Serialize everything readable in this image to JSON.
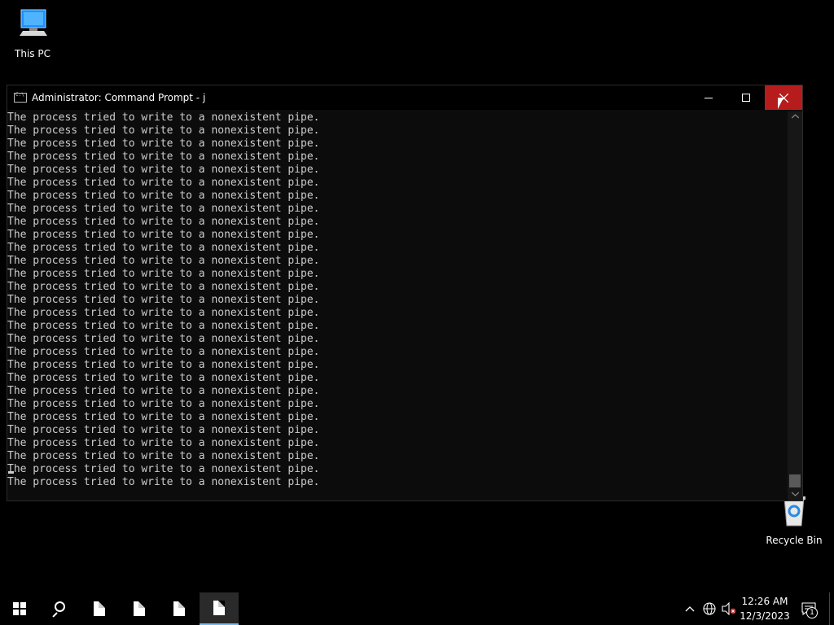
{
  "desktop": {
    "icons": [
      {
        "label": "This PC",
        "icon": "computer-icon"
      },
      {
        "label": "Recycle Bin",
        "icon": "recycle-bin-icon"
      }
    ]
  },
  "window": {
    "title": "Administrator: Command Prompt - j",
    "controls": {
      "minimize": "minimize-icon",
      "maximize": "maximize-icon",
      "close": "close-icon"
    },
    "console_lines": [
      "The process tried to write to a nonexistent pipe.",
      "The process tried to write to a nonexistent pipe.",
      "The process tried to write to a nonexistent pipe.",
      "The process tried to write to a nonexistent pipe.",
      "The process tried to write to a nonexistent pipe.",
      "The process tried to write to a nonexistent pipe.",
      "The process tried to write to a nonexistent pipe.",
      "The process tried to write to a nonexistent pipe.",
      "The process tried to write to a nonexistent pipe.",
      "The process tried to write to a nonexistent pipe.",
      "The process tried to write to a nonexistent pipe.",
      "The process tried to write to a nonexistent pipe.",
      "The process tried to write to a nonexistent pipe.",
      "The process tried to write to a nonexistent pipe.",
      "The process tried to write to a nonexistent pipe.",
      "The process tried to write to a nonexistent pipe.",
      "The process tried to write to a nonexistent pipe.",
      "The process tried to write to a nonexistent pipe.",
      "The process tried to write to a nonexistent pipe.",
      "The process tried to write to a nonexistent pipe.",
      "The process tried to write to a nonexistent pipe.",
      "The process tried to write to a nonexistent pipe.",
      "The process tried to write to a nonexistent pipe.",
      "The process tried to write to a nonexistent pipe.",
      "The process tried to write to a nonexistent pipe.",
      "The process tried to write to a nonexistent pipe.",
      "The process tried to write to a nonexistent pipe.",
      "The process tried to write to a nonexistent pipe.",
      "The process tried to write to a nonexistent pipe."
    ],
    "scroll_position": 1.0
  },
  "taskbar": {
    "items": [
      "start-icon",
      "search-icon",
      "file-icon",
      "file-icon",
      "file-icon",
      "file-icon"
    ],
    "active_index": 5,
    "tray": {
      "time": "12:26 AM",
      "date": "12/3/2023",
      "notification_count": "1"
    }
  },
  "colors": {
    "console_text": "#cccccc",
    "console_bg": "#0c0c0c",
    "close_button": "#b71c1c",
    "taskbar_bg": "#000000",
    "active_task_underline": "#76b9ed"
  }
}
